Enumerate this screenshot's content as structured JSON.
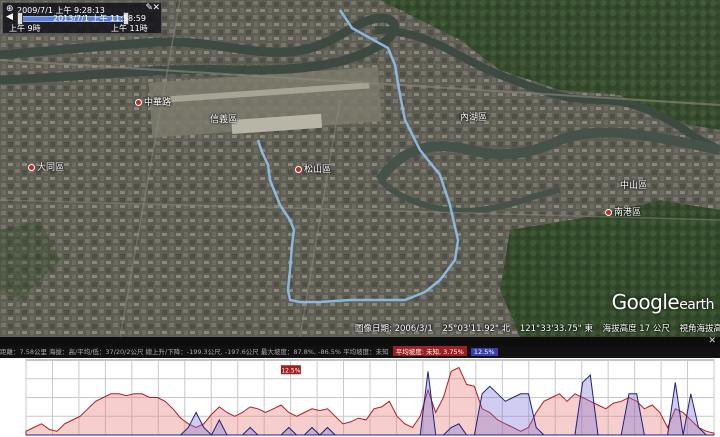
{
  "slider": {
    "start_label": "2009/7/1 上午 9:28:13",
    "end_label": "2013/7/1 上午 11:58:59",
    "time_left": "上午 9時",
    "time_right": "上午 11時"
  },
  "places": [
    {
      "name": "中華路",
      "dot": true
    },
    {
      "name": "松山區",
      "dot": true
    },
    {
      "name": "南港區",
      "dot": true
    },
    {
      "name": "大同區",
      "dot": true
    },
    {
      "name": "內湖區",
      "dot": false
    },
    {
      "name": "中山區",
      "dot": false
    },
    {
      "name": "信義區",
      "dot": false
    }
  ],
  "logo": {
    "google": "Google",
    "earth": "earth"
  },
  "status": {
    "imagery_date": "圖像日期: 2006/3/1",
    "lat": "25°03'11.92\" 北",
    "lon": "121°33'33.75\" 東",
    "elev": "海拔高度 17 公尺",
    "eye_alt": "視角海拔高度 9.95 公里"
  },
  "profile": {
    "series_start_chip": "平均坡度: 未知, 3.75%",
    "series_chip": "12.5%",
    "info_text": "距離：7.58公里  海拔：高/平均/低：37/20/2公尺  總上升/下降：-199.3公尺, -197.6公尺  最大坡度：87.8%, -86.5%  平均坡度：未知",
    "marker_value": "12.5%"
  },
  "chart_data": {
    "type": "area",
    "series": [
      {
        "name": "",
        "color": "#e57373",
        "values": [
          2,
          4,
          6,
          3,
          2,
          6,
          8,
          10,
          14,
          18,
          20,
          22,
          22,
          21,
          22,
          22,
          20,
          20,
          18,
          14,
          9,
          6,
          4,
          6,
          11,
          15,
          12,
          10,
          12,
          15,
          14,
          12,
          14,
          16,
          12,
          10,
          12,
          14,
          13,
          14,
          10,
          6,
          7,
          9,
          8,
          14,
          15,
          18,
          10,
          6,
          4,
          10,
          24,
          12,
          20,
          34,
          36,
          27,
          26,
          14,
          12,
          8,
          6,
          4,
          2,
          4,
          12,
          18,
          20,
          22,
          18,
          22,
          20,
          18,
          16,
          14,
          17,
          18,
          20,
          18,
          14,
          16,
          12,
          4,
          14,
          12,
          8,
          4,
          2,
          1
        ]
      },
      {
        "name": "",
        "color": "#7b6fd6",
        "values": [
          0,
          0,
          0,
          0,
          0,
          0,
          0,
          0,
          0,
          0,
          0,
          0,
          0,
          0,
          0,
          0,
          0,
          0,
          0,
          0,
          0,
          4,
          12,
          4,
          0,
          8,
          0,
          0,
          0,
          4,
          0,
          0,
          0,
          0,
          4,
          0,
          0,
          4,
          0,
          4,
          0,
          0,
          0,
          0,
          0,
          0,
          0,
          0,
          0,
          0,
          0,
          0,
          34,
          0,
          0,
          4,
          6,
          0,
          0,
          22,
          26,
          22,
          18,
          20,
          22,
          22,
          4,
          0,
          0,
          0,
          0,
          0,
          28,
          32,
          0,
          0,
          0,
          0,
          22,
          22,
          0,
          0,
          0,
          0,
          28,
          0,
          22,
          4,
          0,
          0
        ]
      }
    ],
    "ylim": [
      0,
      40
    ]
  }
}
